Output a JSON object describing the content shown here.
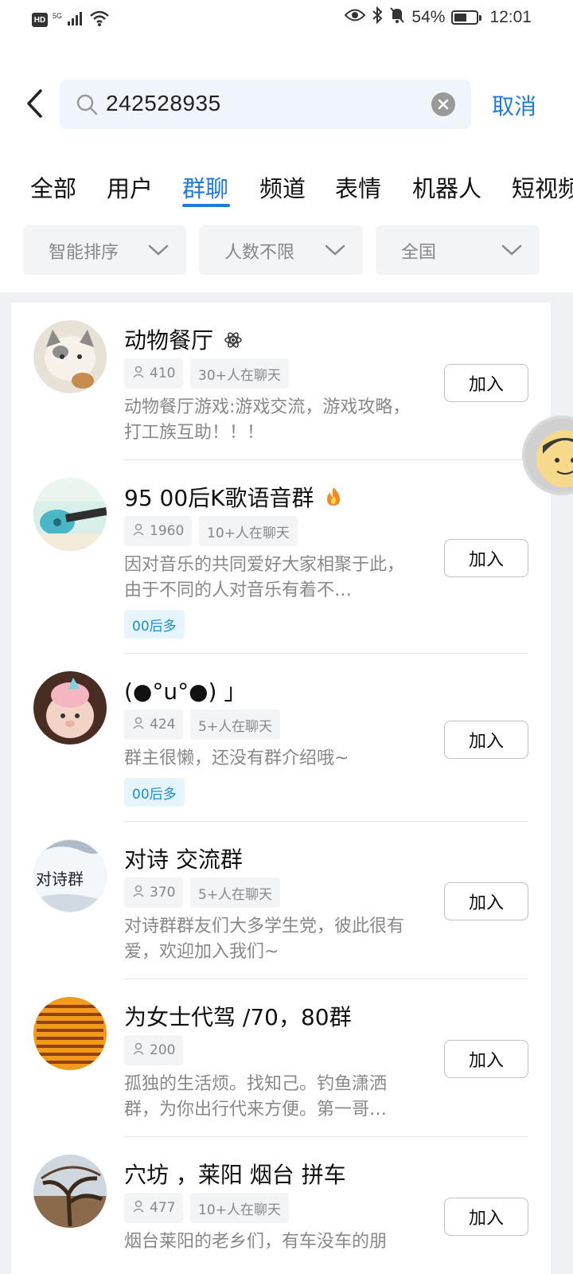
{
  "status_bar": {
    "hd": "HD",
    "network": "5G",
    "battery": "54%",
    "time": "12:01"
  },
  "search": {
    "query": "242528935",
    "cancel_label": "取消"
  },
  "tabs": [
    {
      "label": "全部"
    },
    {
      "label": "用户"
    },
    {
      "label": "群聊"
    },
    {
      "label": "频道"
    },
    {
      "label": "表情"
    },
    {
      "label": "机器人"
    },
    {
      "label": "短视频"
    }
  ],
  "active_tab": "群聊",
  "filters": [
    {
      "label": "智能排序"
    },
    {
      "label": "人数不限"
    },
    {
      "label": "全国"
    }
  ],
  "groups": [
    {
      "name": "动物餐厅",
      "badge_icon": "atom-icon",
      "members": "410",
      "chatting": "30+人在聊天",
      "description": "动物餐厅游戏:游戏交流，游戏攻略，打工族互助！！！",
      "tag": "",
      "join_label": "加入"
    },
    {
      "name": "95 00后K歌语音群",
      "badge_icon": "fire-icon",
      "members": "1960",
      "chatting": "10+人在聊天",
      "description": "因对音乐的共同爱好大家相聚于此，由于不同的人对音乐有着不…",
      "tag": "00后多",
      "join_label": "加入"
    },
    {
      "name": "(●°u°●) 」",
      "badge_icon": "",
      "members": "424",
      "chatting": "5+人在聊天",
      "description": "群主很懒，还没有群介绍哦~",
      "tag": "00后多",
      "join_label": "加入"
    },
    {
      "name": "对诗 交流群",
      "badge_icon": "",
      "members": "370",
      "chatting": "5+人在聊天",
      "description": "对诗群群友们大多学生党，彼此很有爱，欢迎加入我们~",
      "tag": "",
      "avatar_text": "对诗群",
      "join_label": "加入"
    },
    {
      "name": "为女士代驾  /70，80群",
      "badge_icon": "",
      "members": "200",
      "chatting": "",
      "description": "孤独的生活烦。找知己。钓鱼潇洒群，为你出行代来方便。第一哥…",
      "tag": "",
      "join_label": "加入"
    },
    {
      "name": "穴坊 ，莱阳 烟台 拼车",
      "badge_icon": "",
      "members": "477",
      "chatting": "10+人在聊天",
      "description": "烟台莱阳的老乡们，有车没车的朋",
      "tag": "",
      "join_label": "加入"
    }
  ]
}
